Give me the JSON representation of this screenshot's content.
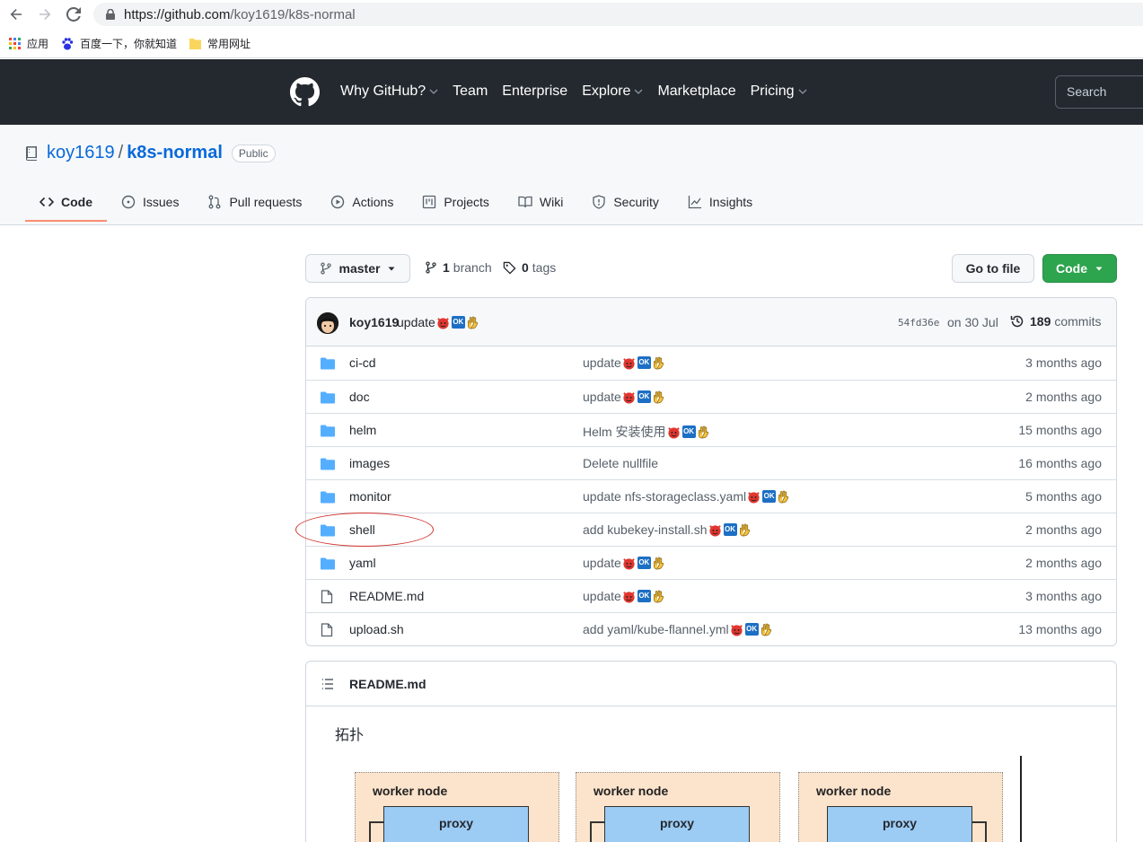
{
  "browser": {
    "url_host": "https://github.com",
    "url_path": "/koy1619/k8s-normal",
    "bookmarks": [
      {
        "label": "应用",
        "icon": "apps-grid-icon"
      },
      {
        "label": "百度一下，你就知道",
        "icon": "baidu-paw-icon"
      },
      {
        "label": "常用网址",
        "icon": "folder-icon"
      }
    ]
  },
  "header": {
    "nav": [
      {
        "label": "Why GitHub?",
        "dropdown": true
      },
      {
        "label": "Team",
        "dropdown": false
      },
      {
        "label": "Enterprise",
        "dropdown": false
      },
      {
        "label": "Explore",
        "dropdown": true
      },
      {
        "label": "Marketplace",
        "dropdown": false
      },
      {
        "label": "Pricing",
        "dropdown": true
      }
    ],
    "search_placeholder": "Search"
  },
  "repo": {
    "owner": "koy1619",
    "separator": "/",
    "name": "k8s-normal",
    "visibility": "Public",
    "tabs": [
      {
        "label": "Code",
        "icon": "code-icon",
        "active": true
      },
      {
        "label": "Issues",
        "icon": "issue-icon"
      },
      {
        "label": "Pull requests",
        "icon": "pull-request-icon"
      },
      {
        "label": "Actions",
        "icon": "play-icon"
      },
      {
        "label": "Projects",
        "icon": "project-icon"
      },
      {
        "label": "Wiki",
        "icon": "book-icon"
      },
      {
        "label": "Security",
        "icon": "shield-icon"
      },
      {
        "label": "Insights",
        "icon": "graph-icon"
      }
    ]
  },
  "toolbar": {
    "branch": "master",
    "branch_count": "1",
    "branch_label": "branch",
    "tag_count": "0",
    "tag_label": "tags",
    "go_to_file": "Go to file",
    "code_button": "Code"
  },
  "latest_commit": {
    "user": "koy1619",
    "message": "update",
    "sha": "54fd36e",
    "date": "on 30 Jul",
    "commit_count": "189",
    "commit_label": "commits"
  },
  "files": [
    {
      "name": "ci-cd",
      "type": "folder",
      "message": "update",
      "emoji": true,
      "age": "3 months ago"
    },
    {
      "name": "doc",
      "type": "folder",
      "message": "update",
      "emoji": true,
      "age": "2 months ago"
    },
    {
      "name": "helm",
      "type": "folder",
      "message": "Helm 安装使用",
      "emoji": true,
      "age": "15 months ago"
    },
    {
      "name": "images",
      "type": "folder",
      "message": "Delete nullfile",
      "emoji": false,
      "age": "16 months ago"
    },
    {
      "name": "monitor",
      "type": "folder",
      "message": "update nfs-storageclass.yaml",
      "emoji": true,
      "age": "5 months ago"
    },
    {
      "name": "shell",
      "type": "folder",
      "message": "add kubekey-install.sh",
      "emoji": true,
      "age": "2 months ago"
    },
    {
      "name": "yaml",
      "type": "folder",
      "message": "update",
      "emoji": true,
      "age": "2 months ago"
    },
    {
      "name": "README.md",
      "type": "file",
      "message": "update",
      "emoji": true,
      "age": "3 months ago"
    },
    {
      "name": "upload.sh",
      "type": "file",
      "message": "add yaml/kube-flannel.yml",
      "emoji": true,
      "age": "13 months ago"
    }
  ],
  "readme": {
    "title": "README.md",
    "heading": "拓扑",
    "diagram_nodes": [
      {
        "label": "worker node",
        "service": "proxy"
      },
      {
        "label": "worker node",
        "service": "proxy"
      },
      {
        "label": "worker node",
        "service": "proxy"
      }
    ]
  },
  "emoji_ok_text": "OK",
  "colors": {
    "header_bg": "#24292f",
    "link": "#0969da",
    "green": "#2da44e",
    "folder": "#54aeff",
    "annotation": "#d0312d"
  }
}
